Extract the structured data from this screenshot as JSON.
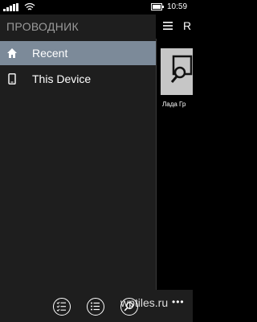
{
  "status_bar": {
    "time": "10:59"
  },
  "header": {
    "title": "ПРОВОДНИК",
    "right_letter": "R"
  },
  "sidebar": {
    "items": [
      {
        "label": "Recent",
        "icon": "home-icon",
        "active": true
      },
      {
        "label": "This Device",
        "icon": "phone-icon",
        "active": false
      }
    ]
  },
  "preview": {
    "label": "Лада Гр"
  },
  "watermark": "wptiles.ru",
  "app_bar": {
    "more": "•••"
  },
  "colors": {
    "sidebar_bg": "#1e1e1e",
    "active_item_bg": "#7c8a99",
    "thumb_bg": "#c6c6c6"
  }
}
